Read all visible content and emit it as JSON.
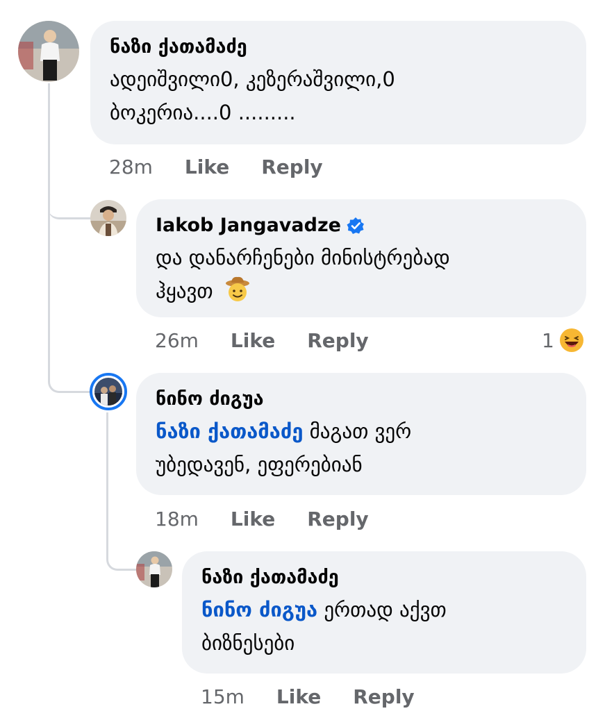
{
  "comments": [
    {
      "author": "ნაზი ქათამაძე",
      "text": "ადეიშვილი0, კეზერაშვილი,0 ბოკერია....0 .........",
      "text_line1": "ადეიშვილი0, კეზერაშვილი,0",
      "text_line2": "ბოკერია....0 .........",
      "time": "28m",
      "like_label": "Like",
      "reply_label": "Reply"
    },
    {
      "author": "Iakob Jangavadze",
      "verified": true,
      "text_line1": "და დანარჩენები მინისტრებად",
      "text_line2": "ჰყავთ",
      "emoji": "cowboy-face-emoji",
      "time": "26m",
      "like_label": "Like",
      "reply_label": "Reply",
      "reaction_count": "1",
      "reaction_emoji": "laughing-face-emoji"
    },
    {
      "author": "ნინო ძიგუა",
      "mention": "ნაზი ქათამაძე",
      "text_line1_rest": "მაგათ ვერ",
      "text_line2": "უბედავენ, ეფერებიან",
      "time": "18m",
      "like_label": "Like",
      "reply_label": "Reply"
    },
    {
      "author": "ნაზი ქათამაძე",
      "mention": "ნინო ძიგუა",
      "text_line1_rest": "ერთად აქვთ",
      "text_line2": "ბიზნესები",
      "time": "15m",
      "like_label": "Like",
      "reply_label": "Reply"
    }
  ],
  "colors": {
    "bubble": "#f0f2f5",
    "mention": "#0a58c9",
    "meta": "#65676b",
    "verified": "#1877f2",
    "story_ring": "#1877f2"
  }
}
